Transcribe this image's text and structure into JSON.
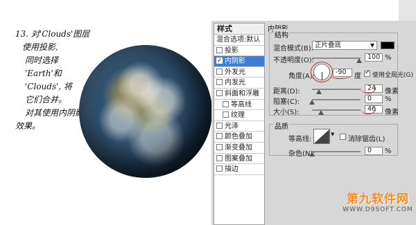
{
  "notes": {
    "lines": [
      "13. 对'Clouds'图层",
      "使用投影,",
      "同时选择",
      "'Earth'和",
      "'Clouds', 将",
      "它们合并。",
      "对其使用内阴影",
      "效果。"
    ]
  },
  "styles_panel": {
    "title": "样式",
    "items": [
      {
        "label": "混合选项:默认",
        "checkbox": false,
        "checked": false,
        "active": false,
        "sub": false
      },
      {
        "label": "投影",
        "checkbox": true,
        "checked": false,
        "active": false,
        "sub": false
      },
      {
        "label": "内阴影",
        "checkbox": true,
        "checked": true,
        "active": true,
        "sub": false
      },
      {
        "label": "外发光",
        "checkbox": true,
        "checked": false,
        "active": false,
        "sub": false
      },
      {
        "label": "内发光",
        "checkbox": true,
        "checked": false,
        "active": false,
        "sub": false
      },
      {
        "label": "斜面和浮雕",
        "checkbox": true,
        "checked": false,
        "active": false,
        "sub": false
      },
      {
        "label": "等高线",
        "checkbox": true,
        "checked": false,
        "active": false,
        "sub": true
      },
      {
        "label": "纹理",
        "checkbox": true,
        "checked": false,
        "active": false,
        "sub": true
      },
      {
        "label": "光泽",
        "checkbox": true,
        "checked": false,
        "active": false,
        "sub": false
      },
      {
        "label": "颜色叠加",
        "checkbox": true,
        "checked": false,
        "active": false,
        "sub": false
      },
      {
        "label": "渐变叠加",
        "checkbox": true,
        "checked": false,
        "active": false,
        "sub": false
      },
      {
        "label": "图案叠加",
        "checkbox": true,
        "checked": false,
        "active": false,
        "sub": false
      },
      {
        "label": "描边",
        "checkbox": true,
        "checked": false,
        "active": false,
        "sub": false
      }
    ]
  },
  "inner_shadow": {
    "title": "内阴影",
    "structure_title": "结构",
    "blend_mode_label": "混合模式(B):",
    "blend_mode_value": "正片叠底",
    "shadow_color": "#000000",
    "opacity_label": "不透明度(O):",
    "opacity_value": "100",
    "opacity_unit": "%",
    "angle_label": "角度(A):",
    "angle_value": "-90",
    "angle_unit": "度",
    "global_light_label": "使用全局光(G)",
    "global_light_checked": true,
    "distance_label": "距离(D):",
    "distance_value": "24",
    "distance_unit": "像素",
    "choke_label": "阻塞(C):",
    "choke_value": "0",
    "choke_unit": "%",
    "size_label": "大小(S):",
    "size_value": "46",
    "size_unit": "像素",
    "quality_title": "品质",
    "contour_label": "等高线:",
    "antialias_label": "消除锯齿(L)",
    "antialias_checked": false,
    "noise_label": "杂色(N):",
    "noise_value": "0",
    "noise_unit": "%"
  },
  "watermark": {
    "title": "第九软件网",
    "url": "WWW.D9SOFT.COM"
  },
  "colors": {
    "accent": "#3b7fd6",
    "annotation": "#c0392b",
    "watermark": "#ff8a1d"
  }
}
